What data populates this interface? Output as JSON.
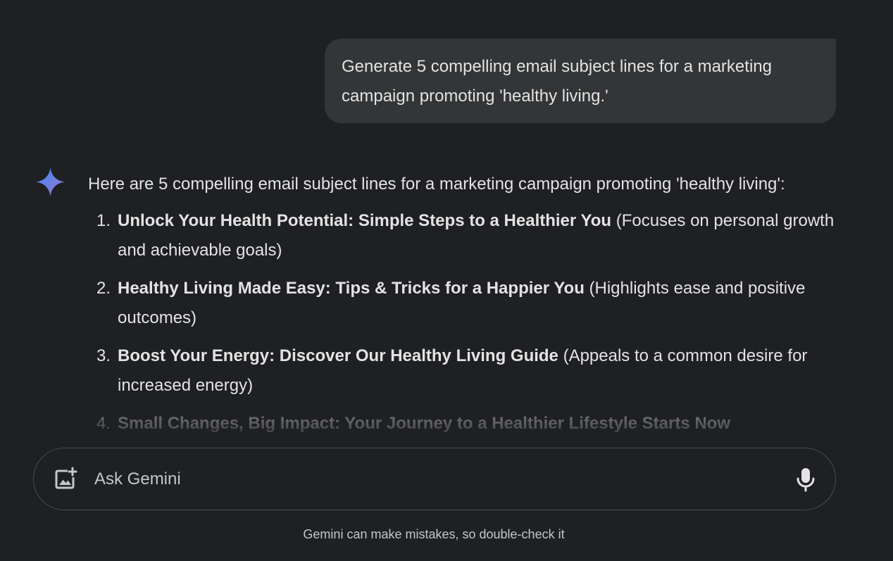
{
  "conversation": {
    "user_prompt": "Generate 5 compelling email subject lines for a marketing campaign promoting 'healthy living.'",
    "response": {
      "intro": "Here are 5 compelling email subject lines for a marketing campaign promoting 'healthy living':",
      "items": [
        {
          "number": "1.",
          "subject": "Unlock Your Health Potential: Simple Steps to a Healthier You",
          "note": " (Focuses on personal growth and achievable goals)"
        },
        {
          "number": "2.",
          "subject": "Healthy Living Made Easy: Tips & Tricks for a Happier You",
          "note": " (Highlights ease and positive outcomes)"
        },
        {
          "number": "3.",
          "subject": "Boost Your Energy: Discover Our Healthy Living Guide",
          "note": " (Appeals to a common desire for increased energy)"
        },
        {
          "number": "4.",
          "subject": "Small Changes, Big Impact: Your Journey to a Healthier Lifestyle Starts Now",
          "note": ""
        }
      ]
    }
  },
  "input": {
    "placeholder": "Ask Gemini",
    "value": ""
  },
  "icons": {
    "assistant": "gemini-sparkle-icon",
    "upload": "add-image-icon",
    "voice": "microphone-icon"
  },
  "footer": {
    "disclaimer": "Gemini can make mistakes, so double-check it"
  },
  "colors": {
    "background": "#1f2023",
    "user_bubble": "#333537",
    "text": "#e3e3e3",
    "muted_text": "#c4c7c5",
    "input_border": "#4a4b4e",
    "sparkle_blue": "#4285f4",
    "sparkle_purple": "#9b72cb"
  }
}
